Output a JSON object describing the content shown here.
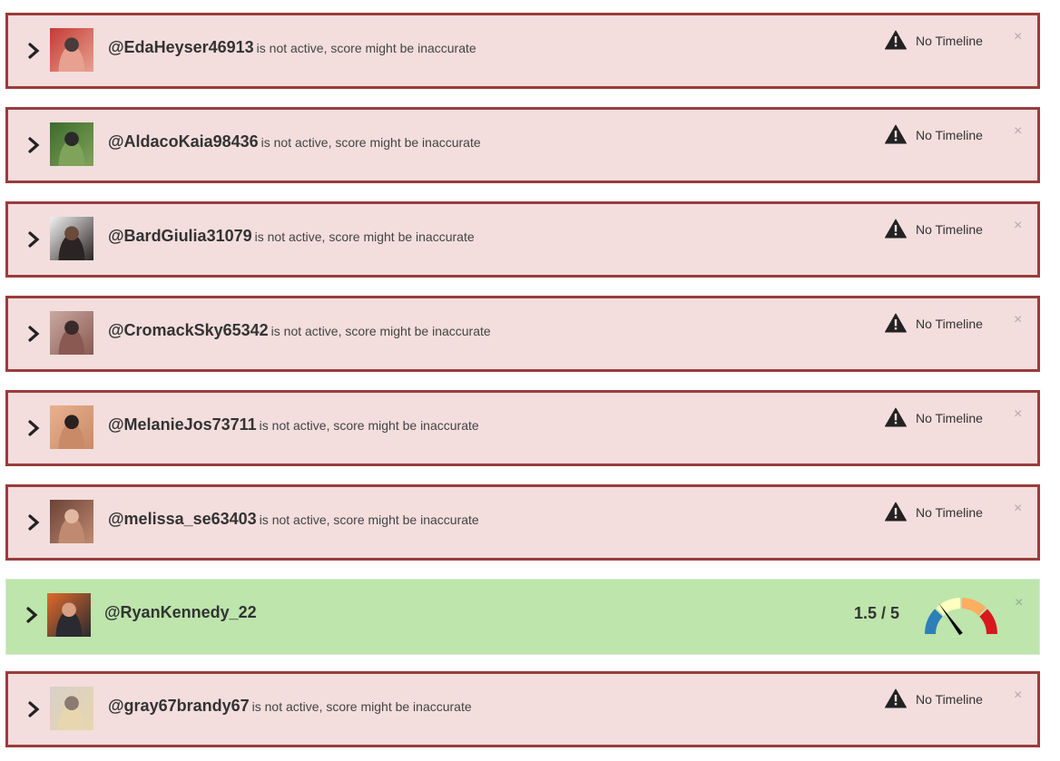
{
  "rows": [
    {
      "state": "inactive",
      "username": "@EdaHeyser46913",
      "status": "is not active, score might be inaccurate",
      "warning_label": "No Timeline",
      "close_label": "×",
      "avatar_colors": [
        "#c43b34",
        "#e8a090",
        "#4a3a3a"
      ]
    },
    {
      "state": "inactive",
      "username": "@AldacoKaia98436",
      "status": "is not active, score might be inaccurate",
      "warning_label": "No Timeline",
      "close_label": "×",
      "avatar_colors": [
        "#3d6b2c",
        "#7fa35a",
        "#2a2a2a"
      ]
    },
    {
      "state": "inactive",
      "username": "@BardGiulia31079",
      "status": "is not active, score might be inaccurate",
      "warning_label": "No Timeline",
      "close_label": "×",
      "avatar_colors": [
        "#f2f2f2",
        "#2a2424",
        "#6a4a3a"
      ]
    },
    {
      "state": "inactive",
      "username": "@CromackSky65342",
      "status": "is not active, score might be inaccurate",
      "warning_label": "No Timeline",
      "close_label": "×",
      "avatar_colors": [
        "#c9a9a0",
        "#8a5a52",
        "#3a2a2a"
      ]
    },
    {
      "state": "inactive",
      "username": "@MelanieJos73711",
      "status": "is not active, score might be inaccurate",
      "warning_label": "No Timeline",
      "close_label": "×",
      "avatar_colors": [
        "#e8b18e",
        "#c98a68",
        "#2a2020"
      ]
    },
    {
      "state": "inactive",
      "username": "@melissa_se63403",
      "status": "is not active, score might be inaccurate",
      "warning_label": "No Timeline",
      "close_label": "×",
      "avatar_colors": [
        "#6a4236",
        "#c08a70",
        "#e2b8a0"
      ]
    },
    {
      "state": "active",
      "username": "@RyanKennedy_22",
      "status": "",
      "score": "1.5 / 5",
      "score_value": 1.5,
      "score_max": 5,
      "close_label": "×",
      "avatar_colors": [
        "#e06a2a",
        "#2a2a30",
        "#d8a080"
      ]
    },
    {
      "state": "inactive",
      "username": "@gray67brandy67",
      "status": "is not active, score might be inaccurate",
      "warning_label": "No Timeline",
      "close_label": "×",
      "avatar_colors": [
        "#d8d0c8",
        "#e8d6b0",
        "#8a7a70"
      ]
    }
  ],
  "colors": {
    "inactive_bg": "#f3dddd",
    "inactive_border": "#9a3c3c",
    "active_bg": "#bde5ac",
    "gauge_segments": [
      "#2c7fb8",
      "#ffffbf",
      "#fdae61",
      "#d7191c"
    ],
    "needle": "#000000"
  },
  "icons": {
    "expand": "chevron-right-icon",
    "warning": "warning-triangle-icon",
    "close": "close-icon"
  }
}
